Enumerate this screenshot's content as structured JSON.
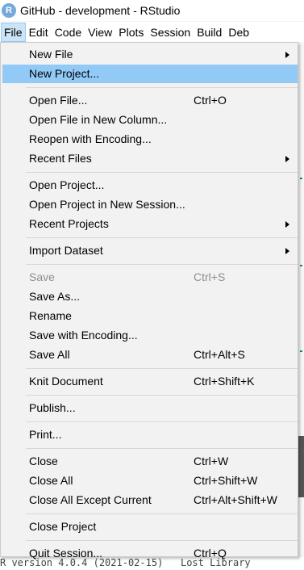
{
  "window": {
    "title": "GitHub - development - RStudio",
    "icon_letter": "R",
    "icon_name": "rstudio-app-icon"
  },
  "menubar": {
    "items": [
      "File",
      "Edit",
      "Code",
      "View",
      "Plots",
      "Session",
      "Build",
      "Deb"
    ],
    "active": "File"
  },
  "file_menu": {
    "items": [
      {
        "label": "New File",
        "shortcut": "",
        "submenu": true,
        "disabled": false,
        "highlighted": false
      },
      {
        "label": "New Project...",
        "shortcut": "",
        "submenu": false,
        "disabled": false,
        "highlighted": true
      },
      {
        "label": "Open File...",
        "shortcut": "Ctrl+O",
        "submenu": false,
        "disabled": false,
        "highlighted": false
      },
      {
        "label": "Open File in New Column...",
        "shortcut": "",
        "submenu": false,
        "disabled": false,
        "highlighted": false
      },
      {
        "label": "Reopen with Encoding...",
        "shortcut": "",
        "submenu": false,
        "disabled": false,
        "highlighted": false
      },
      {
        "label": "Recent Files",
        "shortcut": "",
        "submenu": true,
        "disabled": false,
        "highlighted": false
      },
      {
        "label": "Open Project...",
        "shortcut": "",
        "submenu": false,
        "disabled": false,
        "highlighted": false
      },
      {
        "label": "Open Project in New Session...",
        "shortcut": "",
        "submenu": false,
        "disabled": false,
        "highlighted": false
      },
      {
        "label": "Recent Projects",
        "shortcut": "",
        "submenu": true,
        "disabled": false,
        "highlighted": false
      },
      {
        "label": "Import Dataset",
        "shortcut": "",
        "submenu": true,
        "disabled": false,
        "highlighted": false
      },
      {
        "label": "Save",
        "shortcut": "Ctrl+S",
        "submenu": false,
        "disabled": true,
        "highlighted": false
      },
      {
        "label": "Save As...",
        "shortcut": "",
        "submenu": false,
        "disabled": false,
        "highlighted": false
      },
      {
        "label": "Rename",
        "shortcut": "",
        "submenu": false,
        "disabled": false,
        "highlighted": false
      },
      {
        "label": "Save with Encoding...",
        "shortcut": "",
        "submenu": false,
        "disabled": false,
        "highlighted": false
      },
      {
        "label": "Save All",
        "shortcut": "Ctrl+Alt+S",
        "submenu": false,
        "disabled": false,
        "highlighted": false
      },
      {
        "label": "Knit Document",
        "shortcut": "Ctrl+Shift+K",
        "submenu": false,
        "disabled": false,
        "highlighted": false
      },
      {
        "label": "Publish...",
        "shortcut": "",
        "submenu": false,
        "disabled": false,
        "highlighted": false
      },
      {
        "label": "Print...",
        "shortcut": "",
        "submenu": false,
        "disabled": false,
        "highlighted": false
      },
      {
        "label": "Close",
        "shortcut": "Ctrl+W",
        "submenu": false,
        "disabled": false,
        "highlighted": false
      },
      {
        "label": "Close All",
        "shortcut": "Ctrl+Shift+W",
        "submenu": false,
        "disabled": false,
        "highlighted": false
      },
      {
        "label": "Close All Except Current",
        "shortcut": "Ctrl+Alt+Shift+W",
        "submenu": false,
        "disabled": false,
        "highlighted": false
      },
      {
        "label": "Close Project",
        "shortcut": "",
        "submenu": false,
        "disabled": false,
        "highlighted": false
      },
      {
        "label": "Quit Session...",
        "shortcut": "Ctrl+Q",
        "submenu": false,
        "disabled": false,
        "highlighted": false
      }
    ]
  },
  "console": {
    "visible_text": "R version 4.0.4 (2021-02-15)   Lost Library"
  }
}
